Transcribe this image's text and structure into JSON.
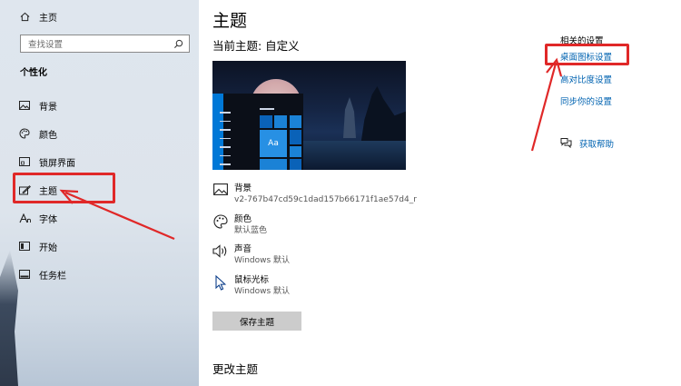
{
  "sidebar": {
    "home_label": "主页",
    "search_placeholder": "查找设置",
    "section_title": "个性化",
    "items": [
      {
        "label": "背景",
        "icon": "image-icon"
      },
      {
        "label": "颜色",
        "icon": "palette-icon"
      },
      {
        "label": "锁屏界面",
        "icon": "lock-screen-icon"
      },
      {
        "label": "主题",
        "icon": "theme-icon",
        "active": true
      },
      {
        "label": "字体",
        "icon": "font-icon"
      },
      {
        "label": "开始",
        "icon": "start-icon"
      },
      {
        "label": "任务栏",
        "icon": "taskbar-icon"
      }
    ]
  },
  "main": {
    "title": "主题",
    "current_theme": "当前主题: 自定义",
    "preview_tile_text": "Aa",
    "properties": [
      {
        "name": "背景",
        "value": "v2-767b47cd59c1dad157b66171f1ae57d4_r",
        "icon": "image-icon"
      },
      {
        "name": "颜色",
        "value": "默认蓝色",
        "icon": "palette-icon"
      },
      {
        "name": "声音",
        "value": "Windows 默认",
        "icon": "speaker-icon"
      },
      {
        "name": "鼠标光标",
        "value": "Windows 默认",
        "icon": "cursor-icon"
      }
    ],
    "save_button": "保存主题",
    "change_theme": "更改主题"
  },
  "related": {
    "title": "相关的设置",
    "links": [
      "桌面图标设置",
      "高对比度设置",
      "同步你的设置"
    ],
    "help": "获取帮助"
  },
  "colors": {
    "accent": "#0078d7",
    "link": "#0063b1",
    "highlight": "#e02828"
  }
}
